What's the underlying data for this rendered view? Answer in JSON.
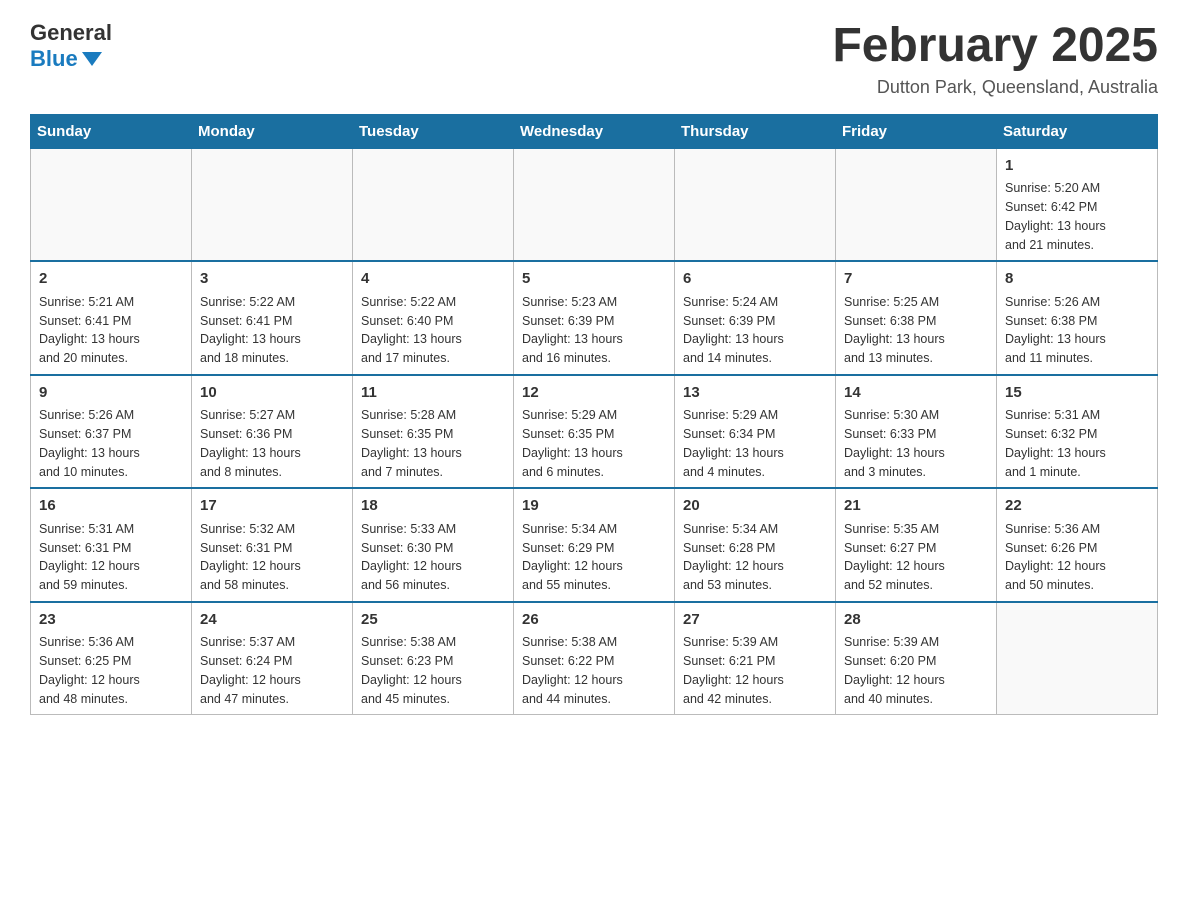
{
  "logo": {
    "general": "General",
    "blue": "Blue"
  },
  "header": {
    "month": "February 2025",
    "location": "Dutton Park, Queensland, Australia"
  },
  "weekdays": [
    "Sunday",
    "Monday",
    "Tuesday",
    "Wednesday",
    "Thursday",
    "Friday",
    "Saturday"
  ],
  "weeks": [
    [
      {
        "day": "",
        "info": ""
      },
      {
        "day": "",
        "info": ""
      },
      {
        "day": "",
        "info": ""
      },
      {
        "day": "",
        "info": ""
      },
      {
        "day": "",
        "info": ""
      },
      {
        "day": "",
        "info": ""
      },
      {
        "day": "1",
        "info": "Sunrise: 5:20 AM\nSunset: 6:42 PM\nDaylight: 13 hours\nand 21 minutes."
      }
    ],
    [
      {
        "day": "2",
        "info": "Sunrise: 5:21 AM\nSunset: 6:41 PM\nDaylight: 13 hours\nand 20 minutes."
      },
      {
        "day": "3",
        "info": "Sunrise: 5:22 AM\nSunset: 6:41 PM\nDaylight: 13 hours\nand 18 minutes."
      },
      {
        "day": "4",
        "info": "Sunrise: 5:22 AM\nSunset: 6:40 PM\nDaylight: 13 hours\nand 17 minutes."
      },
      {
        "day": "5",
        "info": "Sunrise: 5:23 AM\nSunset: 6:39 PM\nDaylight: 13 hours\nand 16 minutes."
      },
      {
        "day": "6",
        "info": "Sunrise: 5:24 AM\nSunset: 6:39 PM\nDaylight: 13 hours\nand 14 minutes."
      },
      {
        "day": "7",
        "info": "Sunrise: 5:25 AM\nSunset: 6:38 PM\nDaylight: 13 hours\nand 13 minutes."
      },
      {
        "day": "8",
        "info": "Sunrise: 5:26 AM\nSunset: 6:38 PM\nDaylight: 13 hours\nand 11 minutes."
      }
    ],
    [
      {
        "day": "9",
        "info": "Sunrise: 5:26 AM\nSunset: 6:37 PM\nDaylight: 13 hours\nand 10 minutes."
      },
      {
        "day": "10",
        "info": "Sunrise: 5:27 AM\nSunset: 6:36 PM\nDaylight: 13 hours\nand 8 minutes."
      },
      {
        "day": "11",
        "info": "Sunrise: 5:28 AM\nSunset: 6:35 PM\nDaylight: 13 hours\nand 7 minutes."
      },
      {
        "day": "12",
        "info": "Sunrise: 5:29 AM\nSunset: 6:35 PM\nDaylight: 13 hours\nand 6 minutes."
      },
      {
        "day": "13",
        "info": "Sunrise: 5:29 AM\nSunset: 6:34 PM\nDaylight: 13 hours\nand 4 minutes."
      },
      {
        "day": "14",
        "info": "Sunrise: 5:30 AM\nSunset: 6:33 PM\nDaylight: 13 hours\nand 3 minutes."
      },
      {
        "day": "15",
        "info": "Sunrise: 5:31 AM\nSunset: 6:32 PM\nDaylight: 13 hours\nand 1 minute."
      }
    ],
    [
      {
        "day": "16",
        "info": "Sunrise: 5:31 AM\nSunset: 6:31 PM\nDaylight: 12 hours\nand 59 minutes."
      },
      {
        "day": "17",
        "info": "Sunrise: 5:32 AM\nSunset: 6:31 PM\nDaylight: 12 hours\nand 58 minutes."
      },
      {
        "day": "18",
        "info": "Sunrise: 5:33 AM\nSunset: 6:30 PM\nDaylight: 12 hours\nand 56 minutes."
      },
      {
        "day": "19",
        "info": "Sunrise: 5:34 AM\nSunset: 6:29 PM\nDaylight: 12 hours\nand 55 minutes."
      },
      {
        "day": "20",
        "info": "Sunrise: 5:34 AM\nSunset: 6:28 PM\nDaylight: 12 hours\nand 53 minutes."
      },
      {
        "day": "21",
        "info": "Sunrise: 5:35 AM\nSunset: 6:27 PM\nDaylight: 12 hours\nand 52 minutes."
      },
      {
        "day": "22",
        "info": "Sunrise: 5:36 AM\nSunset: 6:26 PM\nDaylight: 12 hours\nand 50 minutes."
      }
    ],
    [
      {
        "day": "23",
        "info": "Sunrise: 5:36 AM\nSunset: 6:25 PM\nDaylight: 12 hours\nand 48 minutes."
      },
      {
        "day": "24",
        "info": "Sunrise: 5:37 AM\nSunset: 6:24 PM\nDaylight: 12 hours\nand 47 minutes."
      },
      {
        "day": "25",
        "info": "Sunrise: 5:38 AM\nSunset: 6:23 PM\nDaylight: 12 hours\nand 45 minutes."
      },
      {
        "day": "26",
        "info": "Sunrise: 5:38 AM\nSunset: 6:22 PM\nDaylight: 12 hours\nand 44 minutes."
      },
      {
        "day": "27",
        "info": "Sunrise: 5:39 AM\nSunset: 6:21 PM\nDaylight: 12 hours\nand 42 minutes."
      },
      {
        "day": "28",
        "info": "Sunrise: 5:39 AM\nSunset: 6:20 PM\nDaylight: 12 hours\nand 40 minutes."
      },
      {
        "day": "",
        "info": ""
      }
    ]
  ]
}
